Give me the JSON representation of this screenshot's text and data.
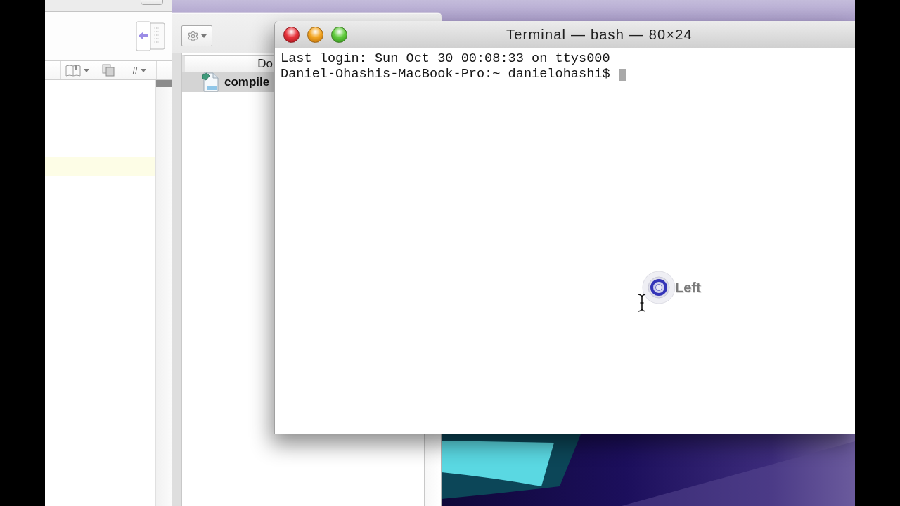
{
  "editor_window": {
    "hash_menu_label": "#"
  },
  "file_browser": {
    "column_header": "Do",
    "rows": [
      {
        "name": "compile",
        "selected": true
      }
    ]
  },
  "terminal": {
    "title": "Terminal — bash — 80×24",
    "lines": [
      "Last login: Sun Oct 30 00:08:33 on ttys000",
      "Daniel-Ohashis-MacBook-Pro:~ danielohashi$"
    ]
  },
  "click_indicator": {
    "label": "Left"
  }
}
